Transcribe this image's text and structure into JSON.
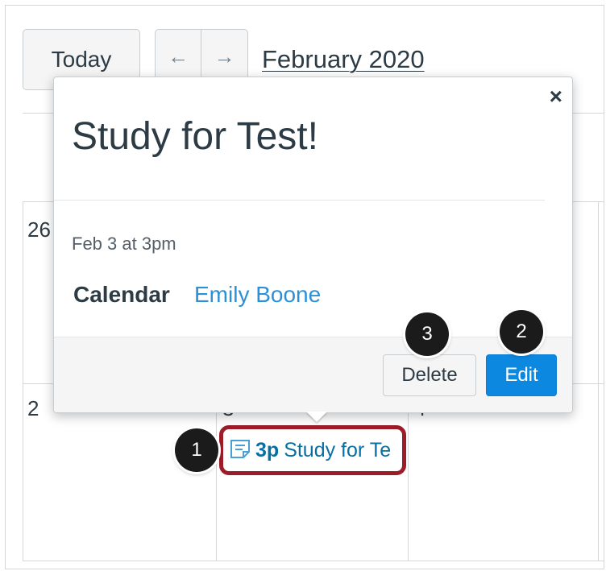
{
  "toolbar": {
    "today_label": "Today",
    "prev_label": "←",
    "next_label": "→",
    "month_title": "February 2020"
  },
  "calendar": {
    "day_26": "26",
    "day_2": "2",
    "day_3": "3",
    "day_4": "4"
  },
  "event": {
    "time": "3p",
    "title": "Study for Te",
    "icon": "note-icon"
  },
  "popover": {
    "title": "Study for Test!",
    "close_label": "×",
    "date": "Feb 3 at 3pm",
    "calendar_label": "Calendar",
    "calendar_value": "Emily Boone",
    "delete_label": "Delete",
    "edit_label": "Edit"
  },
  "callouts": {
    "one": "1",
    "two": "2",
    "three": "3"
  },
  "colors": {
    "edit_button": "#0c88e0",
    "calendar_link": "#2d8fd5",
    "event_highlight": "#9c1c28",
    "event_text": "#0770a3"
  }
}
